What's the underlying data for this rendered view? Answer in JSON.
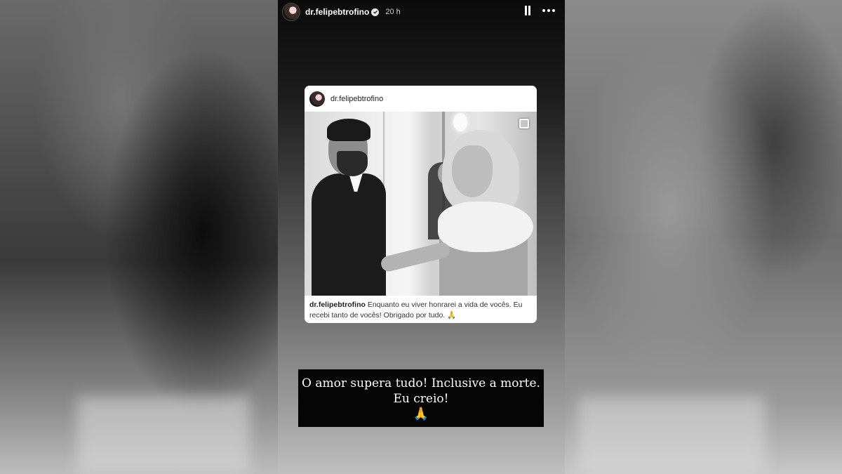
{
  "story": {
    "username": "dr.felipebtrofino",
    "time": "20 h",
    "verified": true
  },
  "post": {
    "username": "dr.felipebtrofino",
    "caption_user": "dr.felipebtrofino",
    "caption_text": "Enquanto eu viver honrarei a vida de vocês. Eu recebi tanto de vocês! Obrigado por tudo. 🙏"
  },
  "sticker": {
    "line1": "O amor supera tudo! Inclusive a morte.",
    "line2": "Eu creio!",
    "emoji": "🙏"
  },
  "icons": {
    "pause": "pause-icon",
    "more": "more-icon",
    "verified": "verified-badge-icon"
  },
  "colors": {
    "sticker_bg": "#050505",
    "card_bg": "#ffffff"
  }
}
